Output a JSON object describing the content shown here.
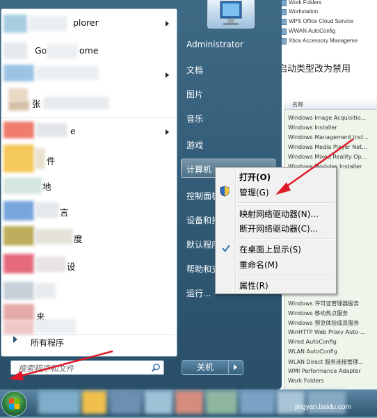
{
  "background_window": {
    "top_services": [
      "Work Folders",
      "Workstation",
      "WPS Office Cloud Service",
      "WWAN AutoConfig",
      "Xbox Accessory Manageme"
    ],
    "banner_text": "启动类型改为禁用",
    "column_header": "名称",
    "services": [
      "Windows Image Acquisitio...",
      "Windows Installer",
      "Windows Management Inst...",
      "Windows Media Player Net...",
      "Windows Mixed Reality Op...",
      "Windows Modules Installer",
      "Windows 许可证管理器服务",
      "Windows 移动热点服务",
      "Windows 预览体验成员服务",
      "WinHTTP Web Proxy Auto-...",
      "Wired AutoConfig",
      "WLAN AutoConfig",
      "WLAN Direct 服务连接管理...",
      "WMI Performance Adapter",
      "Work Folders"
    ]
  },
  "start_menu": {
    "left_items_visible": [
      "plorer",
      "Go",
      "ome",
      "张",
      "e",
      "件",
      "地",
      "言",
      "度",
      "设",
      "来"
    ],
    "all_programs": "所有程序",
    "search_placeholder": "搜索程序和文件",
    "right_items": {
      "user": "Administrator",
      "documents": "文档",
      "pictures": "图片",
      "music": "音乐",
      "games": "游戏",
      "computer": "计算机",
      "control_panel": "控制面板",
      "devices": "设备和打",
      "default_programs": "默认程序",
      "help": "帮助和支",
      "run": "运行..."
    },
    "shutdown_label": "关机"
  },
  "context_menu": {
    "open": "打开(O)",
    "manage": "管理(G)",
    "map_drive": "映射网络驱动器(N)...",
    "disconnect_drive": "断开网络驱动器(C)...",
    "show_on_desktop": "在桌面上显示(S)",
    "rename": "重命名(M)",
    "properties": "属性(R)"
  },
  "watermark": "jingyan.baidu.com",
  "colors": {
    "annotation_arrow": "#e0182a",
    "menu_frame": "#2f5874",
    "check": "#1b5ea8"
  }
}
